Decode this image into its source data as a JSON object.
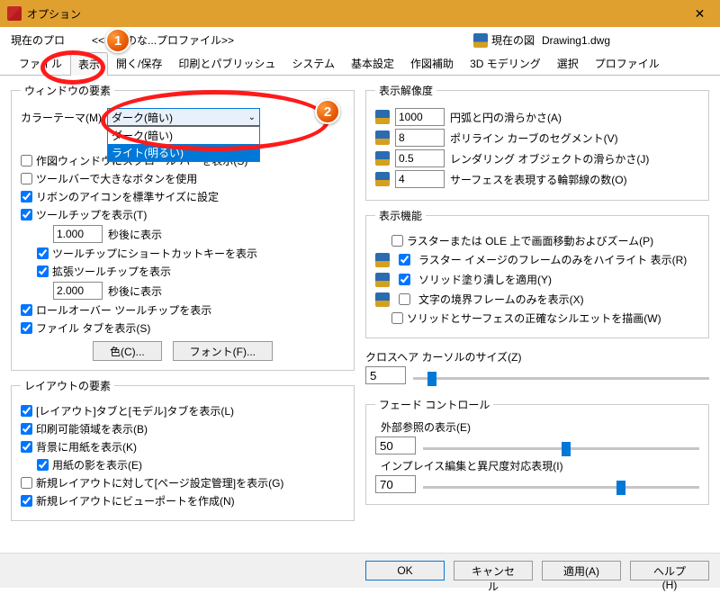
{
  "window": {
    "title": "オプション",
    "close_glyph": "✕"
  },
  "profile_row": {
    "current_profile_label": "現在のプロ",
    "profile_name": "<<名前のな...プロファイル>>",
    "current_drawing_label": "現在の図",
    "drawing_name": "Drawing1.dwg"
  },
  "tabs": {
    "items": [
      "ファイル",
      "表示",
      "開く/保存",
      "印刷とパブリッシュ",
      "システム",
      "基本設定",
      "作図補助",
      "3D モデリング",
      "選択",
      "プロファイル"
    ],
    "active_index": 1
  },
  "window_elements": {
    "legend": "ウィンドウの要素",
    "color_theme_label": "カラーテーマ(M)",
    "dropdown": {
      "selected": "ダーク(暗い)",
      "options": [
        "ダーク(暗い)",
        "ライト(明るい)"
      ],
      "highlighted_index": 1
    },
    "c1": "作図ウィンドウにスクロール バーを表示(S)",
    "c2": "ツールバーで大きなボタンを使用",
    "c3": "リボンのアイコンを標準サイズに設定",
    "c4": "ツールチップを表示(T)",
    "c4_val": "1.000",
    "c4_suffix": "秒後に表示",
    "c5": "ツールチップにショートカットキーを表示",
    "c6": "拡張ツールチップを表示",
    "c6_val": "2.000",
    "c6_suffix": "秒後に表示",
    "c7": "ロールオーバー ツールチップを表示",
    "c8": "ファイル タブを表示(S)",
    "btn_color": "色(C)...",
    "btn_font": "フォント(F)..."
  },
  "layout_elements": {
    "legend": "レイアウトの要素",
    "c1": "[レイアウト]タブと[モデル]タブを表示(L)",
    "c2": "印刷可能領域を表示(B)",
    "c3": "背景に用紙を表示(K)",
    "c4": "用紙の影を表示(E)",
    "c5": "新規レイアウトに対して[ページ設定管理]を表示(G)",
    "c6": "新規レイアウトにビューポートを作成(N)"
  },
  "resolution": {
    "legend": "表示解像度",
    "r1_val": "1000",
    "r1_lbl": "円弧と円の滑らかさ(A)",
    "r2_val": "8",
    "r2_lbl": "ポリライン カーブのセグメント(V)",
    "r3_val": "0.5",
    "r3_lbl": "レンダリング オブジェクトの滑らかさ(J)",
    "r4_val": "4",
    "r4_lbl": "サーフェスを表現する輪郭線の数(O)"
  },
  "perf": {
    "legend": "表示機能",
    "c1": "ラスターまたは OLE 上で画面移動およびズーム(P)",
    "c2": "ラスター イメージのフレームのみをハイライト 表示(R)",
    "c3": "ソリッド塗り潰しを適用(Y)",
    "c4": "文字の境界フレームのみを表示(X)",
    "c5": "ソリッドとサーフェスの正確なシルエットを描画(W)"
  },
  "crosshair": {
    "label": "クロスヘア カーソルのサイズ(Z)",
    "value": "5",
    "pct": 5
  },
  "fade": {
    "legend": "フェード コントロール",
    "xref_label": "外部参照の表示(E)",
    "xref_value": "50",
    "xref_pct": 50,
    "inplace_label": "インプレイス編集と異尺度対応表現(I)",
    "inplace_value": "70",
    "inplace_pct": 70
  },
  "footer": {
    "ok": "OK",
    "cancel": "キャンセル",
    "apply": "適用(A)",
    "help": "ヘルプ(H)"
  },
  "annotations": {
    "badge1": "1",
    "badge2": "2"
  }
}
